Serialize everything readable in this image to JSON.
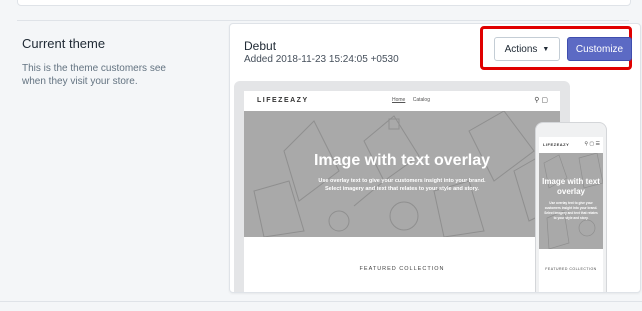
{
  "section": {
    "title": "Current theme",
    "description": "This is the theme customers see when they visit your store."
  },
  "theme": {
    "name": "Debut",
    "added": "Added 2018-11-23 15:24:05 +0530"
  },
  "buttons": {
    "actions_label": "Actions",
    "customize_label": "Customize"
  },
  "preview": {
    "logo": "LIFEZEAZY",
    "nav_links": [
      "Home",
      "Catalog"
    ],
    "hero_title": "Image with text overlay",
    "hero_subtitle_line1": "Use overlay text to give your customers insight into your brand.",
    "hero_subtitle_line2": "Select imagery and text that relates to your style and story.",
    "featured": "FEATURED COLLECTION"
  },
  "mobile_preview": {
    "logo": "LIFEZEAZY",
    "hero_title": "Image with text overlay",
    "hero_subtitle": "Use overlay text to give your customers insight into your brand. Select imagery and text that relates to your style and story.",
    "featured": "FEATURED COLLECTION"
  },
  "colors": {
    "accent": "#5c6ac4",
    "highlight": "#e00000",
    "background": "#f4f6f8"
  }
}
